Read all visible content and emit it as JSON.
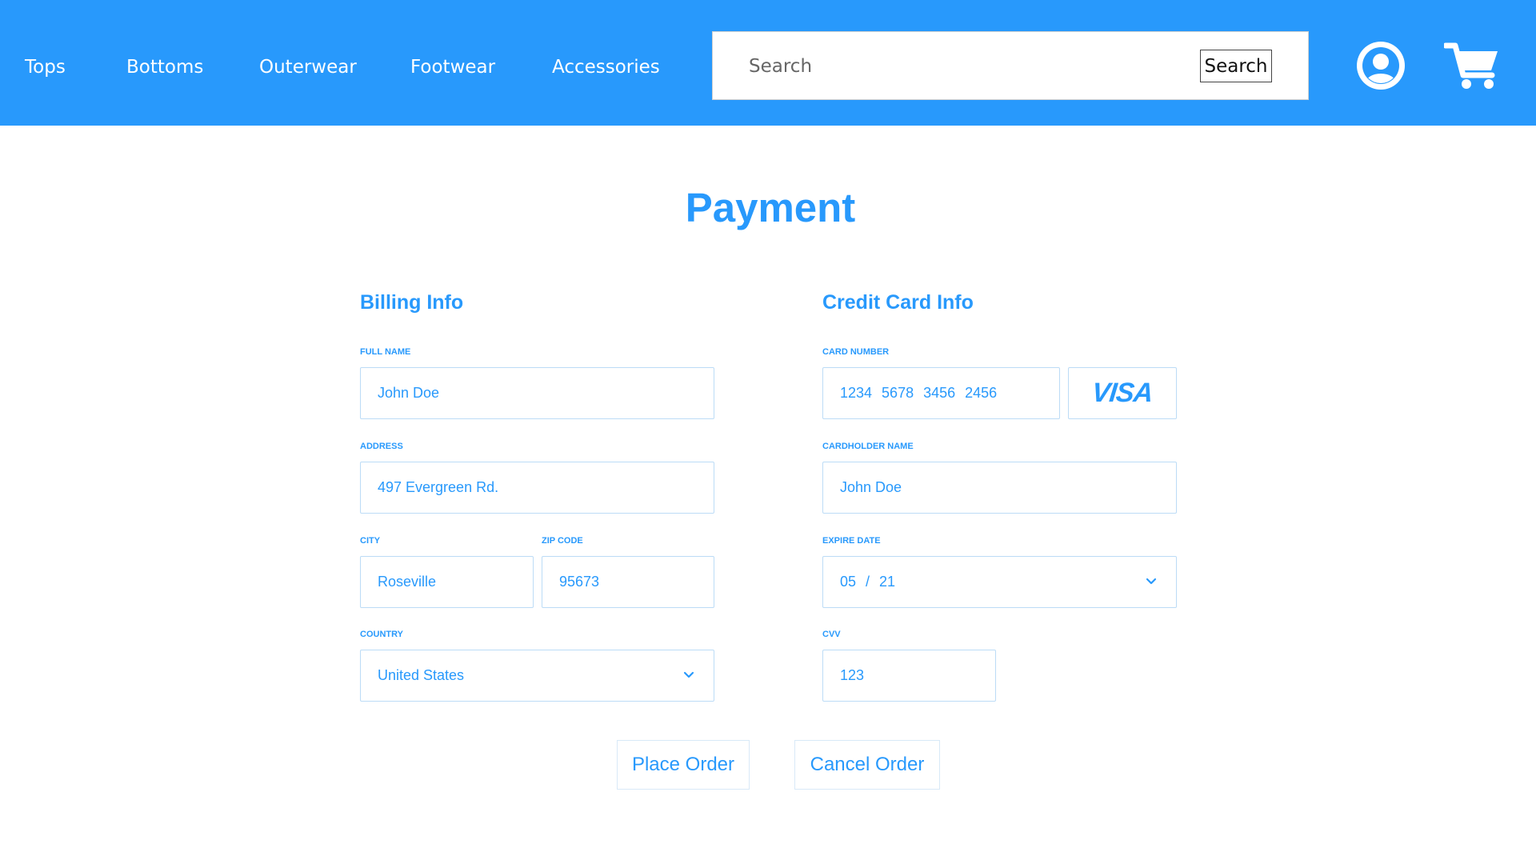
{
  "header": {
    "nav": [
      "Tops",
      "Bottoms",
      "Outerwear",
      "Footwear",
      "Accessories"
    ],
    "search": {
      "placeholder": "Search",
      "button_label": "Search"
    },
    "icons": {
      "account": "user-circle-icon",
      "cart": "shopping-cart-icon"
    },
    "background_color": "#2899fc"
  },
  "page": {
    "title": "Payment",
    "accent_color": "#2899fc"
  },
  "billing": {
    "title": "Billing Info",
    "full_name": {
      "label": "FULL NAME",
      "value": "John Doe"
    },
    "address": {
      "label": "ADDRESS",
      "value": "497 Evergreen Rd."
    },
    "city": {
      "label": "CITY",
      "value": "Roseville"
    },
    "zip": {
      "label": "ZIP CODE",
      "value": "95673"
    },
    "country": {
      "label": "COUNTRY",
      "value": "United States"
    }
  },
  "card": {
    "title": "Credit Card Info",
    "number": {
      "label": "CARD NUMBER",
      "groups": [
        "1234",
        "5678",
        "3456",
        "2456"
      ]
    },
    "brand": "VISA",
    "holder": {
      "label": "CARDHOLDER NAME",
      "value": "John Doe"
    },
    "expire": {
      "label": "EXPIRE DATE",
      "month": "05",
      "separator": "/",
      "year": "21"
    },
    "cvv": {
      "label": "CVV",
      "value": "123"
    }
  },
  "actions": {
    "place_order": "Place Order",
    "cancel_order": "Cancel Order"
  }
}
